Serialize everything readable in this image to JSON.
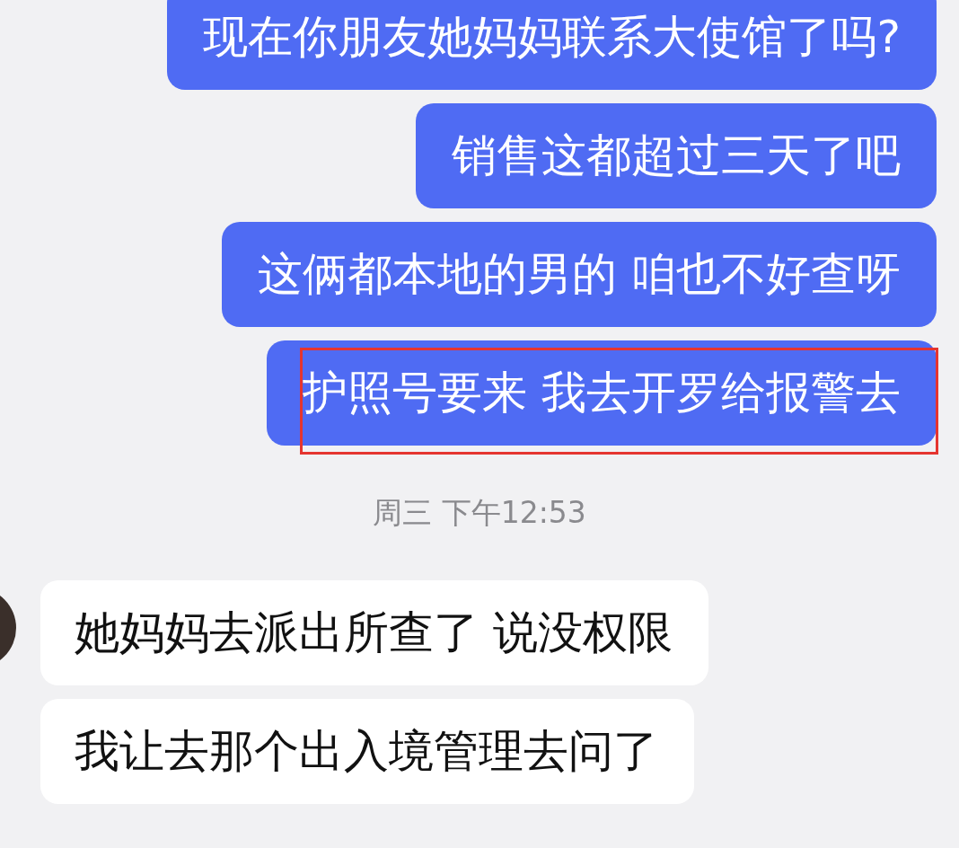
{
  "messages": [
    {
      "kind": "sent",
      "text": "现在你朋友她妈妈联系大使馆了吗?",
      "highlighted": false
    },
    {
      "kind": "sent",
      "text": "销售这都超过三天了吧",
      "highlighted": false
    },
    {
      "kind": "sent",
      "text": "这俩都本地的男的 咱也不好查呀",
      "highlighted": false
    },
    {
      "kind": "sent",
      "text": "护照号要来 我去开罗给报警去",
      "highlighted": true
    },
    {
      "kind": "timestamp",
      "text": "周三 下午12:53"
    },
    {
      "kind": "received",
      "text": "她妈妈去派出所查了 说没权限",
      "avatar": true
    },
    {
      "kind": "received",
      "text": "我让去那个出入境管理去问了",
      "avatar": false
    }
  ]
}
